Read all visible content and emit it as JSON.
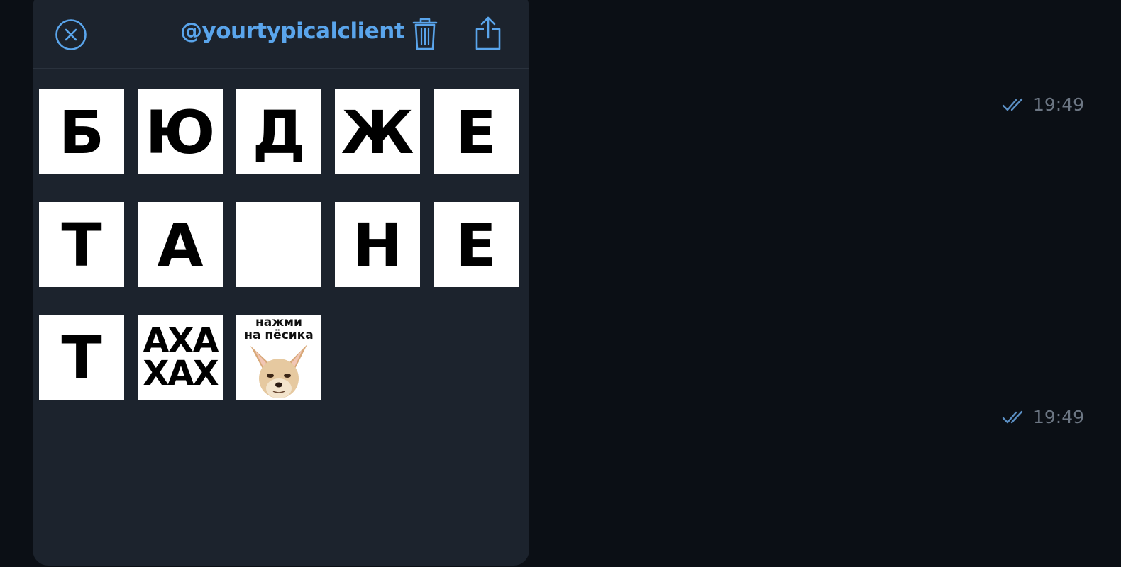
{
  "panel": {
    "title": "@yourtypicalclient",
    "accent_color": "#5aa5ec",
    "close_icon": "close-circle-icon",
    "trash_icon": "trash-icon",
    "share_icon": "share-icon"
  },
  "stickers": {
    "row1": [
      "Б",
      "Ю",
      "Д",
      "Ж",
      "Е"
    ],
    "row2": [
      "Т",
      "А",
      "",
      "Н",
      "Е"
    ],
    "row3_letter": "Т",
    "laugh_line1": "АХА",
    "laugh_line2": "ХАХ",
    "dog_caption": "нажми\nна пёсика"
  },
  "messages": [
    {
      "time": "19:49",
      "status_icon": "double-check-icon"
    },
    {
      "time": "19:49",
      "status_icon": "double-check-icon"
    }
  ]
}
